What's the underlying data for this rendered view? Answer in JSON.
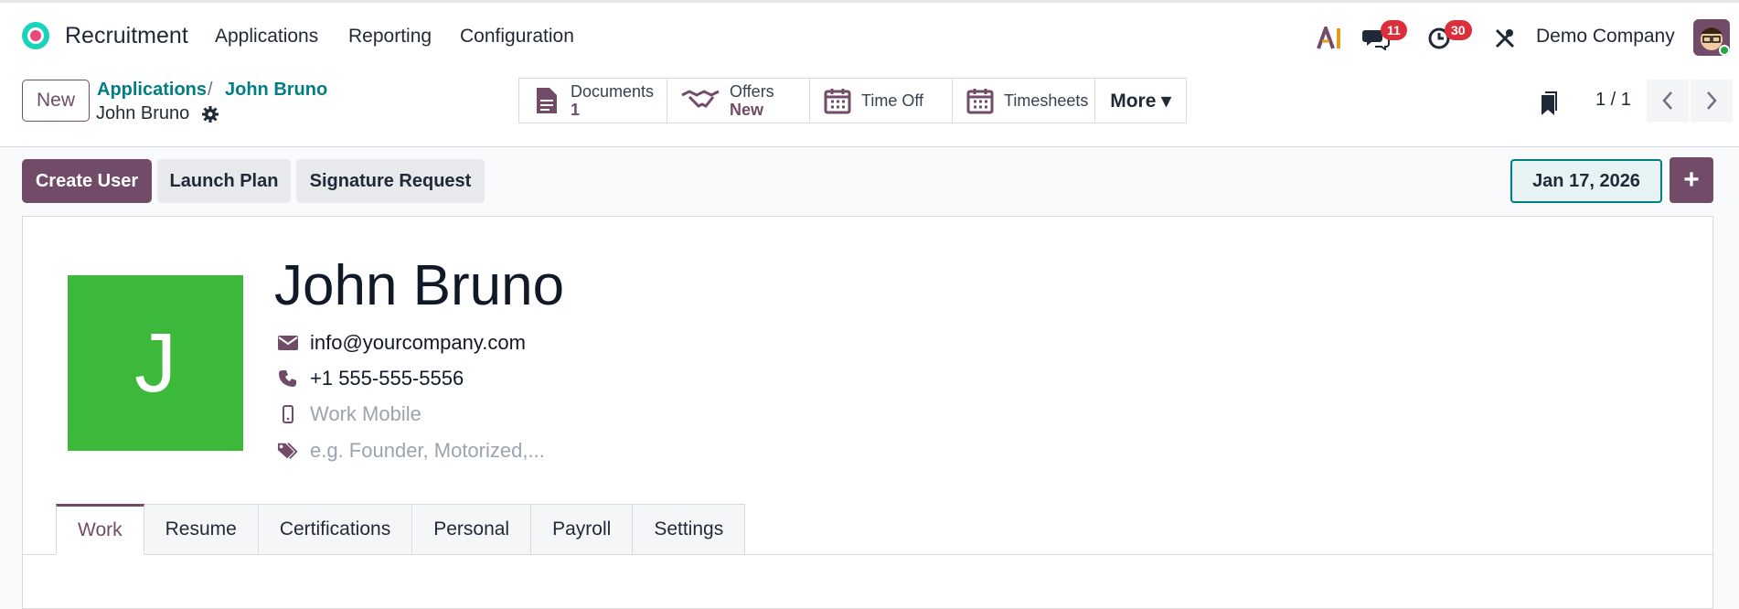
{
  "nav": {
    "app_title": "Recruitment",
    "menus": [
      "Applications",
      "Reporting",
      "Configuration"
    ],
    "messages_count": "11",
    "activities_count": "30",
    "company": "Demo Company"
  },
  "breadcrumb": {
    "new_label": "New",
    "items": [
      "Applications",
      "John Bruno"
    ],
    "separator": "/",
    "current": "John Bruno"
  },
  "smart_buttons": [
    {
      "label": "Documents",
      "sub": "1",
      "icon": "document-icon"
    },
    {
      "label": "Offers",
      "sub": "New",
      "icon": "handshake-icon"
    },
    {
      "label": "Time Off",
      "icon": "calendar-icon"
    },
    {
      "label": "Timesheets",
      "icon": "calendar-icon"
    },
    {
      "label": "More ▾"
    }
  ],
  "pager": {
    "value": "1 / 1"
  },
  "actions": {
    "create_user": "Create User",
    "launch_plan": "Launch Plan",
    "signature_request": "Signature Request",
    "date": "Jan 17, 2026",
    "plus": "+"
  },
  "employee": {
    "initial": "J",
    "name": "John Bruno",
    "email": "info@yourcompany.com",
    "phone": "+1 555-555-5556",
    "mobile_placeholder": "Work Mobile",
    "tags_placeholder": "e.g. Founder, Motorized,..."
  },
  "tabs": [
    "Work",
    "Resume",
    "Certifications",
    "Personal",
    "Payroll",
    "Settings"
  ],
  "colors": {
    "brand": "#714b67",
    "link": "#017e84",
    "avatar_bg": "#3cb93a",
    "badge": "#dc2f3c"
  }
}
